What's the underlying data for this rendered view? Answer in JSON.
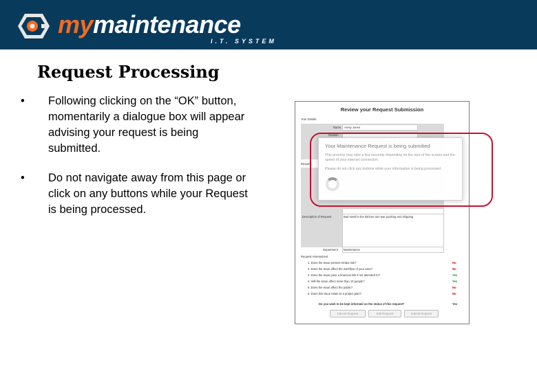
{
  "brand": {
    "logo_my": "my",
    "logo_main": "maintenance",
    "logo_sub": "I.T. SYSTEM",
    "colors": {
      "banner": "#083a5c",
      "accent": "#f26a22",
      "highlight": "#c8102e"
    }
  },
  "slide": {
    "title": "Request Processing",
    "bullets": [
      "Following clicking on the “OK” button, momentarily a dialogue box will appear advising your request is being submitted.",
      "Do not navigate away from this page or click on any buttons while your Request is being processed."
    ],
    "bullet_glyph": "•"
  },
  "screenshot": {
    "title": "Review your Request Submission",
    "your_details": "Your Details",
    "name_label": "Name",
    "name_value": "Annty Jones",
    "division_label": "Division",
    "request_label": "Request",
    "description_label": "Description of Request",
    "description_value": "Bad smell in the kitchen ant near packing and shipping",
    "department_label": "Department",
    "department_value": "Maintenance",
    "request_assessment": "Request Assessment",
    "questions": [
      {
        "q": "1.   Does the issue present OH&S risk?",
        "a": "No"
      },
      {
        "q": "2.   Does the issue affect the workflow of your area?",
        "a": "No"
      },
      {
        "q": "3.   Does the issue pose a financial risk if not attended to?",
        "a": "Yes"
      },
      {
        "q": "4.   Will the issue affect more than 10 people?",
        "a": "Yes"
      },
      {
        "q": "5.   Does the issue affect the public?",
        "a": "No"
      },
      {
        "q": "6.   Does this issue relate to a project plan?",
        "a": "No"
      }
    ],
    "informed_question": "Do you wish to be kept informed on the status of this request?",
    "informed_answer": "Yes",
    "buttons": {
      "cancel": "Cancel Request",
      "edit": "Edit Request",
      "submit": "Submit Request"
    }
  },
  "dialog": {
    "title": "Your Maintenance Request is being submitted",
    "message": "This process may take a few seconds depending on the size of the screen and the speed of your internet connection.",
    "warning": "Please do not click any buttons while your information is being processed.",
    "spinner_icon": "loading-spinner-icon"
  }
}
